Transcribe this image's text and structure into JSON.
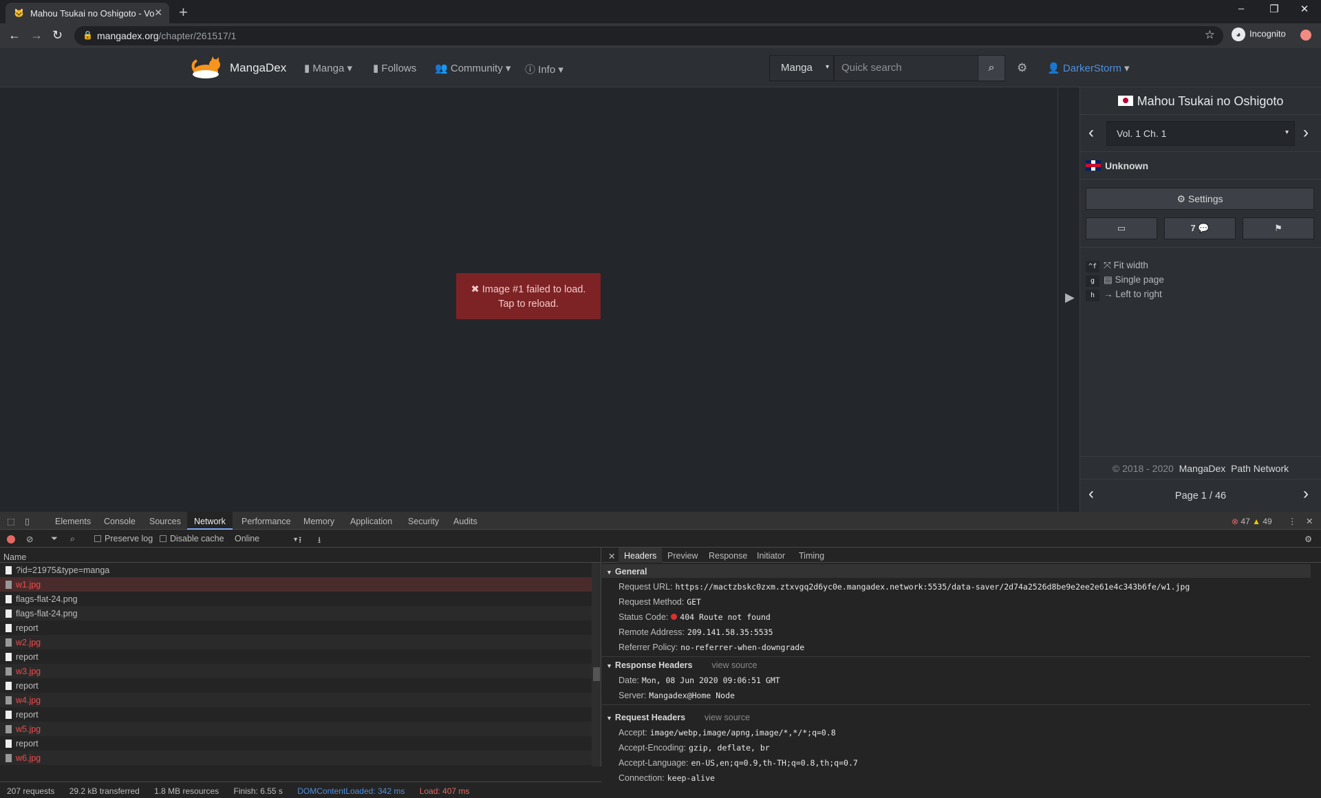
{
  "browser": {
    "tab_title": "Mahou Tsukai no Oshigoto - Vol.",
    "url_domain": "mangadex.org",
    "url_path": "/chapter/261517/1",
    "incognito_label": "Incognito"
  },
  "site_nav": {
    "brand": "MangaDex",
    "items": [
      "Manga",
      "Follows",
      "Community",
      "Info"
    ],
    "search_type": "Manga",
    "search_placeholder": "Quick search",
    "username": "DarkerStorm"
  },
  "reader": {
    "error_line1": "Image #1 failed to load.",
    "error_line2": "Tap to reload.",
    "progress_fraction": 0.0217,
    "total_pages": 46
  },
  "sidebar": {
    "manga_title": "Mahou Tsukai no Oshigoto",
    "chapter": "Vol. 1 Ch. 1",
    "group": "Unknown",
    "settings_label": "Settings",
    "comments_count": "7",
    "shortcuts": [
      {
        "key": "^f",
        "label": "Fit width"
      },
      {
        "key": "g",
        "label": "Single page"
      },
      {
        "key": "h",
        "label": "Left to right"
      }
    ],
    "footer_copy": "© 2018 - 2020",
    "footer_brand": "MangaDex",
    "footer_network": "Path Network",
    "page_label": "Page 1 / 46"
  },
  "devtools": {
    "tabs": [
      "Elements",
      "Console",
      "Sources",
      "Network",
      "Performance",
      "Memory",
      "Application",
      "Security",
      "Audits"
    ],
    "error_count": "47",
    "warning_count": "49",
    "preserve_log": "Preserve log",
    "disable_cache": "Disable cache",
    "throttle": "Online",
    "name_header": "Name",
    "requests": [
      {
        "name": "?id=21975&type=manga",
        "error": false
      },
      {
        "name": "w1.jpg",
        "error": true
      },
      {
        "name": "flags-flat-24.png",
        "error": false
      },
      {
        "name": "flags-flat-24.png",
        "error": false
      },
      {
        "name": "report",
        "error": false
      },
      {
        "name": "w2.jpg",
        "error": true
      },
      {
        "name": "report",
        "error": false
      },
      {
        "name": "w3.jpg",
        "error": true
      },
      {
        "name": "report",
        "error": false
      },
      {
        "name": "w4.jpg",
        "error": true
      },
      {
        "name": "report",
        "error": false
      },
      {
        "name": "w5.jpg",
        "error": true
      },
      {
        "name": "report",
        "error": false
      },
      {
        "name": "w6.jpg",
        "error": true
      },
      {
        "name": "report",
        "error": false
      }
    ],
    "status": {
      "requests": "207 requests",
      "transferred": "29.2 kB transferred",
      "resources": "1.8 MB resources",
      "finish": "Finish: 6.55 s",
      "dcl": "DOMContentLoaded: 342 ms",
      "load": "Load: 407 ms"
    },
    "detail_tabs": [
      "Headers",
      "Preview",
      "Response",
      "Initiator",
      "Timing"
    ],
    "general_title": "General",
    "general": [
      {
        "k": "Request URL:",
        "v": "https://mactzbskc0zxm.ztxvgq2d6yc0e.mangadex.network:5535/data-saver/2d74a2526d8be9e2ee2e61e4c343b6fe/w1.jpg"
      },
      {
        "k": "Request Method:",
        "v": "GET"
      },
      {
        "k": "Status Code:",
        "v": "404 Route not found"
      },
      {
        "k": "Remote Address:",
        "v": "209.141.58.35:5535"
      },
      {
        "k": "Referrer Policy:",
        "v": "no-referrer-when-downgrade"
      }
    ],
    "response_headers_title": "Response Headers",
    "view_source": "view source",
    "response_headers": [
      {
        "k": "Date:",
        "v": "Mon, 08 Jun 2020 09:06:51 GMT"
      },
      {
        "k": "Server:",
        "v": "Mangadex@Home Node"
      }
    ],
    "request_headers_title": "Request Headers",
    "request_headers": [
      {
        "k": "Accept:",
        "v": "image/webp,image/apng,image/*,*/*;q=0.8"
      },
      {
        "k": "Accept-Encoding:",
        "v": "gzip, deflate, br"
      },
      {
        "k": "Accept-Language:",
        "v": "en-US,en;q=0.9,th-TH;q=0.8,th;q=0.7"
      },
      {
        "k": "Connection:",
        "v": "keep-alive"
      }
    ]
  }
}
